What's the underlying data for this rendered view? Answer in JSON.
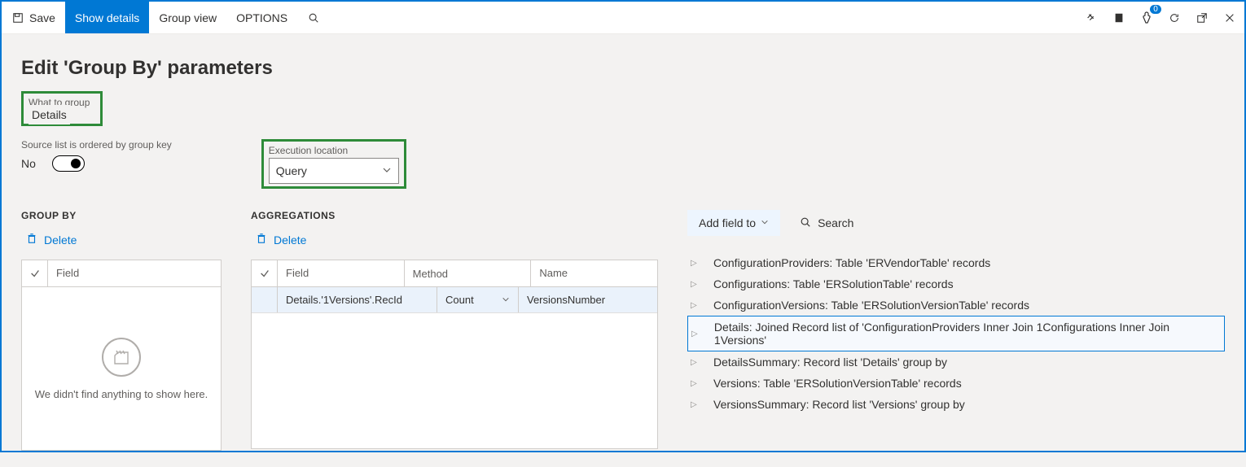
{
  "toolbar": {
    "save": "Save",
    "show_details": "Show details",
    "group_view": "Group view",
    "options": "OPTIONS",
    "notif_count": "0"
  },
  "page_title": "Edit 'Group By' parameters",
  "what_to_group": {
    "label": "What to group",
    "value": "Details"
  },
  "ordered": {
    "label": "Source list is ordered by group key",
    "value": "No"
  },
  "exec_loc": {
    "label": "Execution location",
    "value": "Query"
  },
  "groupby": {
    "heading": "GROUP BY",
    "delete": "Delete",
    "col_field": "Field",
    "empty_msg": "We didn't find anything to show here."
  },
  "agg": {
    "heading": "AGGREGATIONS",
    "delete": "Delete",
    "col_field": "Field",
    "col_method": "Method",
    "col_name": "Name",
    "rows": [
      {
        "field": "Details.'1Versions'.RecId",
        "method": "Count",
        "name": "VersionsNumber"
      }
    ]
  },
  "tree": {
    "add_field_to": "Add field to",
    "search": "Search",
    "items": [
      "ConfigurationProviders: Table 'ERVendorTable' records",
      "Configurations: Table 'ERSolutionTable' records",
      "ConfigurationVersions: Table 'ERSolutionVersionTable' records",
      "Details: Joined Record list of 'ConfigurationProviders Inner Join 1Configurations Inner Join 1Versions'",
      "DetailsSummary: Record list 'Details' group by",
      "Versions: Table 'ERSolutionVersionTable' records",
      "VersionsSummary: Record list 'Versions' group by"
    ],
    "selected_index": 3
  }
}
